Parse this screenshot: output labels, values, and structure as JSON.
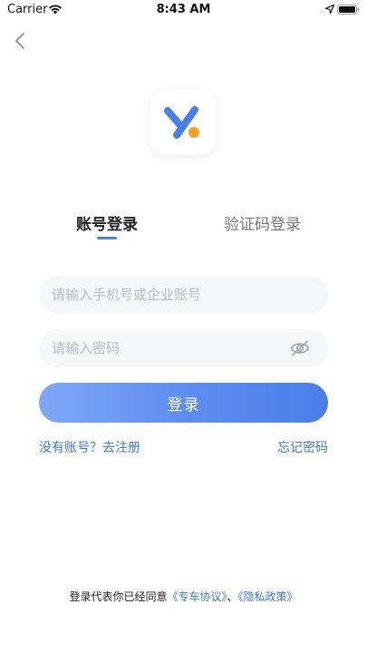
{
  "status_bar": {
    "carrier": "Carrier",
    "time": "8:43 AM"
  },
  "nav": {
    "back_icon": "chevron-left-icon"
  },
  "logo": {
    "icon": "app-logo-icon",
    "colors": {
      "primary": "#4a7ee8",
      "accent": "#f5a31a"
    }
  },
  "tabs": [
    {
      "label": "账号登录",
      "active": true
    },
    {
      "label": "验证码登录",
      "active": false
    }
  ],
  "form": {
    "phone_placeholder": "请输入手机号或企业账号",
    "phone_value": "",
    "password_placeholder": "请输入密码",
    "password_value": "",
    "eye_icon": "eye-icon",
    "login_label": "登录"
  },
  "links": {
    "register": "没有账号？去注册",
    "forgot": "忘记密码"
  },
  "agreement": {
    "prefix": "登录代表你已经同意",
    "terms": "《专车协议》",
    "separator": "、",
    "privacy": "《隐私政策》"
  },
  "colors": {
    "accent": "#4a7ee8",
    "link": "#3d78d8",
    "field_bg": "#f6f7f9"
  }
}
